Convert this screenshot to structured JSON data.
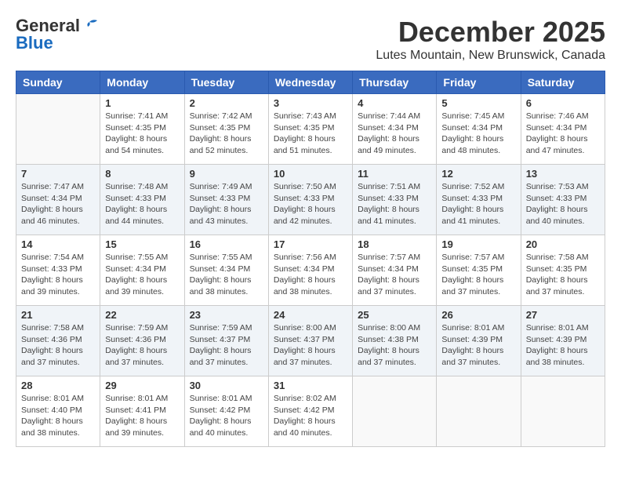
{
  "logo": {
    "general": "General",
    "blue": "Blue"
  },
  "title": {
    "month_year": "December 2025",
    "location": "Lutes Mountain, New Brunswick, Canada"
  },
  "headers": [
    "Sunday",
    "Monday",
    "Tuesday",
    "Wednesday",
    "Thursday",
    "Friday",
    "Saturday"
  ],
  "weeks": [
    [
      {
        "day": "",
        "info": ""
      },
      {
        "day": "1",
        "info": "Sunrise: 7:41 AM\nSunset: 4:35 PM\nDaylight: 8 hours\nand 54 minutes."
      },
      {
        "day": "2",
        "info": "Sunrise: 7:42 AM\nSunset: 4:35 PM\nDaylight: 8 hours\nand 52 minutes."
      },
      {
        "day": "3",
        "info": "Sunrise: 7:43 AM\nSunset: 4:35 PM\nDaylight: 8 hours\nand 51 minutes."
      },
      {
        "day": "4",
        "info": "Sunrise: 7:44 AM\nSunset: 4:34 PM\nDaylight: 8 hours\nand 49 minutes."
      },
      {
        "day": "5",
        "info": "Sunrise: 7:45 AM\nSunset: 4:34 PM\nDaylight: 8 hours\nand 48 minutes."
      },
      {
        "day": "6",
        "info": "Sunrise: 7:46 AM\nSunset: 4:34 PM\nDaylight: 8 hours\nand 47 minutes."
      }
    ],
    [
      {
        "day": "7",
        "info": "Sunrise: 7:47 AM\nSunset: 4:34 PM\nDaylight: 8 hours\nand 46 minutes."
      },
      {
        "day": "8",
        "info": "Sunrise: 7:48 AM\nSunset: 4:33 PM\nDaylight: 8 hours\nand 44 minutes."
      },
      {
        "day": "9",
        "info": "Sunrise: 7:49 AM\nSunset: 4:33 PM\nDaylight: 8 hours\nand 43 minutes."
      },
      {
        "day": "10",
        "info": "Sunrise: 7:50 AM\nSunset: 4:33 PM\nDaylight: 8 hours\nand 42 minutes."
      },
      {
        "day": "11",
        "info": "Sunrise: 7:51 AM\nSunset: 4:33 PM\nDaylight: 8 hours\nand 41 minutes."
      },
      {
        "day": "12",
        "info": "Sunrise: 7:52 AM\nSunset: 4:33 PM\nDaylight: 8 hours\nand 41 minutes."
      },
      {
        "day": "13",
        "info": "Sunrise: 7:53 AM\nSunset: 4:33 PM\nDaylight: 8 hours\nand 40 minutes."
      }
    ],
    [
      {
        "day": "14",
        "info": "Sunrise: 7:54 AM\nSunset: 4:33 PM\nDaylight: 8 hours\nand 39 minutes."
      },
      {
        "day": "15",
        "info": "Sunrise: 7:55 AM\nSunset: 4:34 PM\nDaylight: 8 hours\nand 39 minutes."
      },
      {
        "day": "16",
        "info": "Sunrise: 7:55 AM\nSunset: 4:34 PM\nDaylight: 8 hours\nand 38 minutes."
      },
      {
        "day": "17",
        "info": "Sunrise: 7:56 AM\nSunset: 4:34 PM\nDaylight: 8 hours\nand 38 minutes."
      },
      {
        "day": "18",
        "info": "Sunrise: 7:57 AM\nSunset: 4:34 PM\nDaylight: 8 hours\nand 37 minutes."
      },
      {
        "day": "19",
        "info": "Sunrise: 7:57 AM\nSunset: 4:35 PM\nDaylight: 8 hours\nand 37 minutes."
      },
      {
        "day": "20",
        "info": "Sunrise: 7:58 AM\nSunset: 4:35 PM\nDaylight: 8 hours\nand 37 minutes."
      }
    ],
    [
      {
        "day": "21",
        "info": "Sunrise: 7:58 AM\nSunset: 4:36 PM\nDaylight: 8 hours\nand 37 minutes."
      },
      {
        "day": "22",
        "info": "Sunrise: 7:59 AM\nSunset: 4:36 PM\nDaylight: 8 hours\nand 37 minutes."
      },
      {
        "day": "23",
        "info": "Sunrise: 7:59 AM\nSunset: 4:37 PM\nDaylight: 8 hours\nand 37 minutes."
      },
      {
        "day": "24",
        "info": "Sunrise: 8:00 AM\nSunset: 4:37 PM\nDaylight: 8 hours\nand 37 minutes."
      },
      {
        "day": "25",
        "info": "Sunrise: 8:00 AM\nSunset: 4:38 PM\nDaylight: 8 hours\nand 37 minutes."
      },
      {
        "day": "26",
        "info": "Sunrise: 8:01 AM\nSunset: 4:39 PM\nDaylight: 8 hours\nand 37 minutes."
      },
      {
        "day": "27",
        "info": "Sunrise: 8:01 AM\nSunset: 4:39 PM\nDaylight: 8 hours\nand 38 minutes."
      }
    ],
    [
      {
        "day": "28",
        "info": "Sunrise: 8:01 AM\nSunset: 4:40 PM\nDaylight: 8 hours\nand 38 minutes."
      },
      {
        "day": "29",
        "info": "Sunrise: 8:01 AM\nSunset: 4:41 PM\nDaylight: 8 hours\nand 39 minutes."
      },
      {
        "day": "30",
        "info": "Sunrise: 8:01 AM\nSunset: 4:42 PM\nDaylight: 8 hours\nand 40 minutes."
      },
      {
        "day": "31",
        "info": "Sunrise: 8:02 AM\nSunset: 4:42 PM\nDaylight: 8 hours\nand 40 minutes."
      },
      {
        "day": "",
        "info": ""
      },
      {
        "day": "",
        "info": ""
      },
      {
        "day": "",
        "info": ""
      }
    ]
  ]
}
